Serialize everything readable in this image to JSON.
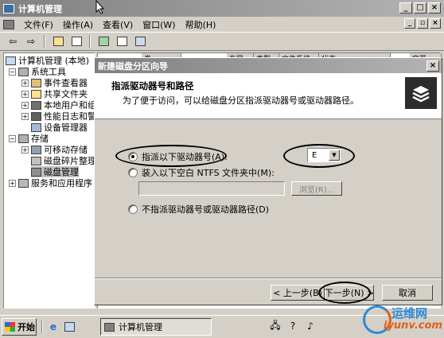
{
  "window": {
    "title": "计算机管理"
  },
  "menu": [
    "文件(F)",
    "操作(A)",
    "查看(V)",
    "窗口(W)",
    "帮助(H)"
  ],
  "tree": {
    "root": "计算机管理 (本地)",
    "system_tools": "系统工具",
    "event_viewer": "事件查看器",
    "shared_folders": "共享文件夹",
    "local_users": "本地用户和组",
    "perf_logs": "性能日志和警",
    "device_manager": "设备管理器",
    "storage": "存储",
    "removable": "可移动存储",
    "defrag": "磁盘碎片整理",
    "disk_mgmt": "磁盘管理",
    "services": "服务和应用程序"
  },
  "columns": [
    "卷",
    "布局",
    "类型",
    "文件系统",
    "状态",
    "容量"
  ],
  "wizard": {
    "title": "新建磁盘分区向导",
    "heading": "指派驱动器号和路径",
    "subtitle": "为了便于访问，可以给磁盘分区指派驱动器号或驱动器路径。",
    "opt_assign": "指派以下驱动器号(A):",
    "drive_letter": "E",
    "opt_mount": "装入以下空白 NTFS 文件夹中(M):",
    "browse_label": "浏览(R)...",
    "opt_none": "不指派驱动器号或驱动器路径(D)",
    "back_label": "< 上一步(B)",
    "next_label": "下一步(N) >",
    "cancel_label": "取消"
  },
  "taskbar": {
    "start_label": "开始",
    "task_label": "计算机管理"
  },
  "watermark": {
    "line1": "运维网",
    "line2": "iyunv.com"
  }
}
